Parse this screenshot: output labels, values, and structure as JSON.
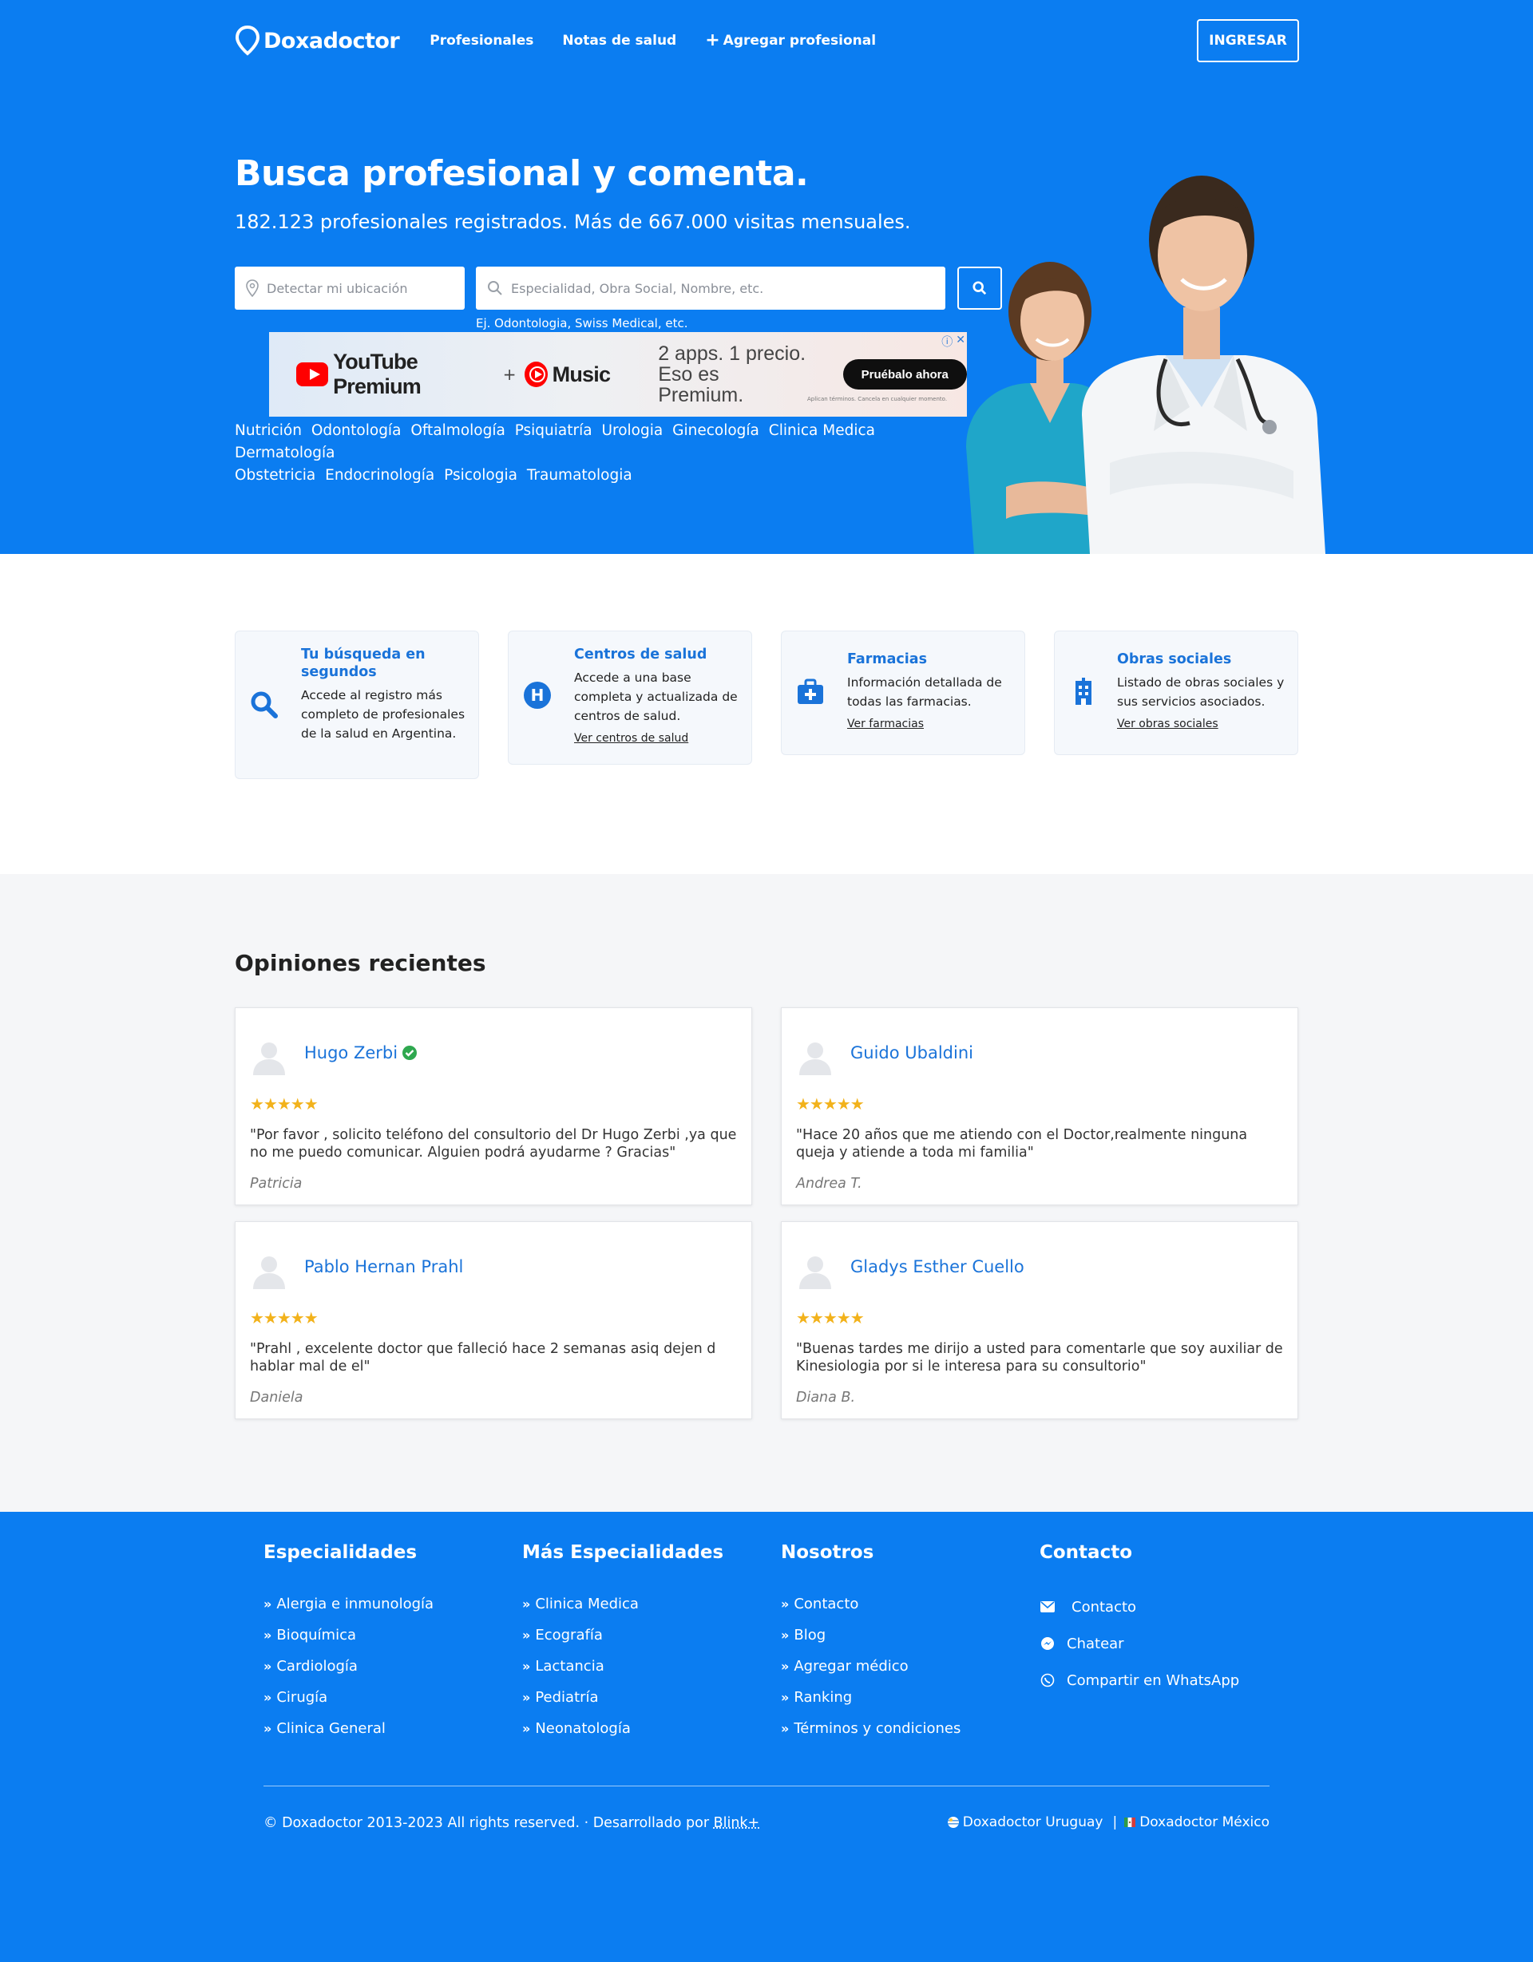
{
  "header": {
    "logo_text": "Doxadoctor",
    "nav": [
      "Profesionales",
      "Notas de salud",
      "Agregar profesional"
    ],
    "login_label": "INGRESAR"
  },
  "hero": {
    "title": "Busca profesional y comenta.",
    "subtitle": "182.123 profesionales registrados. Más de 667.000 visitas mensuales.",
    "location_placeholder": "Detectar mi ubicación",
    "search_placeholder": "Especialidad, Obra Social, Nombre, etc.",
    "hint": "Ej. Odontologia, Swiss Medical, etc.",
    "specialties": [
      "Nutrición",
      "Odontología",
      "Oftalmología",
      "Psiquiatría",
      "Urologia",
      "Ginecología",
      "Clinica Medica",
      "Dermatología",
      "Obstetricia",
      "Endocrinología",
      "Psicologia",
      "Traumatologia"
    ]
  },
  "ad": {
    "brand": "YouTube Premium",
    "plus": "+",
    "music": "Music",
    "tagline": "2 apps. 1 precio. Eso es Premium.",
    "cta": "Pruébalo ahora",
    "fine_print": "Aplican términos. Cancela en cualquier momento."
  },
  "features": [
    {
      "title": "Tu búsqueda en segundos",
      "desc": "Accede al registro más completo de profesionales de la salud en Argentina.",
      "link": ""
    },
    {
      "title": "Centros de salud",
      "desc": "Accede a una base completa y actualizada de centros de salud.",
      "link": "Ver centros de salud"
    },
    {
      "title": "Farmacias",
      "desc": "Información detallada de todas las farmacias.",
      "link": "Ver farmacias"
    },
    {
      "title": "Obras sociales",
      "desc": "Listado de obras sociales y sus servicios asociados.",
      "link": "Ver obras sociales"
    }
  ],
  "opinions": {
    "title": "Opiniones recientes",
    "stars": "★★★★★",
    "items": [
      {
        "name": "Hugo Zerbi",
        "quote": "\"Por favor , solicito teléfono del consultorio del Dr Hugo Zerbi ,ya que no me puedo comunicar. Alguien podrá ayudarme ? Gracias\"",
        "author": "Patricia"
      },
      {
        "name": "Guido Ubaldini",
        "quote": "\"Hace 20 años que me atiendo con el Doctor,realmente ninguna queja y atiende a toda mi familia\"",
        "author": "Andrea T."
      },
      {
        "name": "Pablo Hernan Prahl",
        "quote": "\"Prahl , excelente doctor que falleció hace 2 semanas asiq dejen d hablar mal de el\"",
        "author": "Daniela"
      },
      {
        "name": "Gladys Esther Cuello",
        "quote": "\"Buenas tardes me dirijo a usted para comentarle que soy auxiliar de Kinesiologia por si le interesa para su consultorio\"",
        "author": "Diana B."
      }
    ]
  },
  "footer": {
    "columns": [
      {
        "title": "Especialidades",
        "items": [
          "Alergia e inmunología",
          "Bioquímica",
          "Cardiología",
          "Cirugía",
          "Clinica General"
        ]
      },
      {
        "title": "Más Especialidades",
        "items": [
          "Clinica Medica",
          "Ecografía",
          "Lactancia",
          "Pediatría",
          "Neonatología"
        ]
      },
      {
        "title": "Nosotros",
        "items": [
          "Contacto",
          "Blog",
          "Agregar médico",
          "Ranking",
          "Términos y condiciones"
        ]
      }
    ],
    "contact": {
      "title": "Contacto",
      "items": [
        "Contacto",
        "Chatear",
        "Compartir en WhatsApp"
      ]
    },
    "copyright": "© Doxadoctor 2013-2023 All rights reserved. · Desarrollado por ",
    "dev_link": "Blink+",
    "site_uy": "Doxadoctor Uruguay",
    "separator": "|",
    "site_mx": "Doxadoctor México"
  },
  "colors": {
    "primary": "#0b7df1",
    "link": "#1a73d9",
    "star": "#f2b21b"
  }
}
